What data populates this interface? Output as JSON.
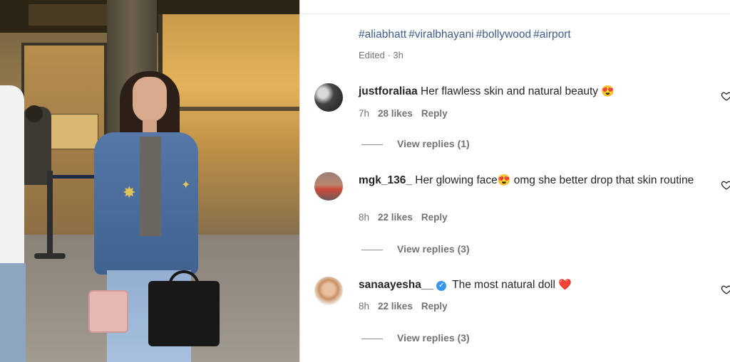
{
  "media": {
    "description_icon": "video-frame"
  },
  "caption": {
    "hashtags": [
      "#aliabhatt",
      "#viralbhayani",
      "#bollywood",
      "#airport"
    ],
    "edited_label": "Edited · 3h"
  },
  "comments": [
    {
      "username": "justforaliaa",
      "verified": false,
      "text": "Her flawless skin and natural beauty",
      "emoji": "😍",
      "time": "7h",
      "likes": "28 likes",
      "reply_label": "Reply",
      "view_replies": "View replies (1)"
    },
    {
      "username": "mgk_136_",
      "verified": false,
      "text_before_emoji": "Her glowing face",
      "emoji": "😍",
      "text_after_emoji": " omg she better drop that skin routine",
      "time": "8h",
      "likes": "22 likes",
      "reply_label": "Reply",
      "view_replies": "View replies (3)"
    },
    {
      "username": "sanaayesha__",
      "verified": true,
      "text": "The most natural doll",
      "emoji": "❤️",
      "time": "8h",
      "likes": "22 likes",
      "reply_label": "Reply",
      "view_replies": "View replies (3)"
    }
  ],
  "colors": {
    "hashtag": "#3f5c89",
    "meta": "#737373",
    "text": "#262626",
    "verified": "#3897f0"
  }
}
